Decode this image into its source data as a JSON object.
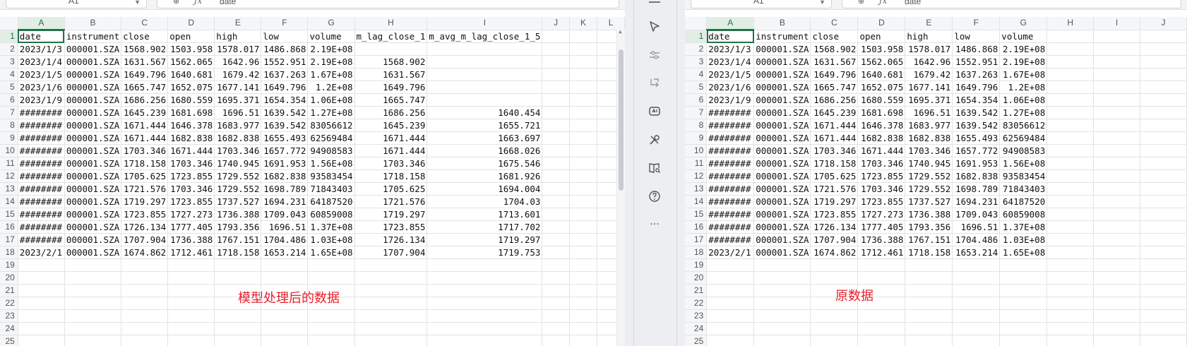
{
  "left_panel": {
    "name_box": "A1",
    "formula_value": "date",
    "caption": "模型处理后的数据",
    "columns": [
      "A",
      "B",
      "C",
      "D",
      "E",
      "F",
      "G",
      "H",
      "I",
      "J",
      "K",
      "L"
    ],
    "row_numbers": [
      "1",
      "2",
      "3",
      "4",
      "5",
      "6",
      "7",
      "8",
      "9",
      "10",
      "11",
      "12",
      "13",
      "14",
      "15",
      "16",
      "17",
      "18",
      "19",
      "20",
      "21",
      "22",
      "23",
      "24",
      "25"
    ],
    "rows": [
      [
        "date",
        "instrument",
        "close",
        "open",
        "high",
        "low",
        "volume",
        "m_lag_close_1",
        "m_avg_m_lag_close_1_5",
        "",
        "",
        ""
      ],
      [
        "2023/1/3",
        "000001.SZA",
        "1568.902",
        "1503.958",
        "1578.017",
        "1486.868",
        "2.19E+08",
        "",
        "",
        "",
        "",
        ""
      ],
      [
        "2023/1/4",
        "000001.SZA",
        "1631.567",
        "1562.065",
        "1642.96",
        "1552.951",
        "2.19E+08",
        "1568.902",
        "",
        "",
        "",
        ""
      ],
      [
        "2023/1/5",
        "000001.SZA",
        "1649.796",
        "1640.681",
        "1679.42",
        "1637.263",
        "1.67E+08",
        "1631.567",
        "",
        "",
        "",
        ""
      ],
      [
        "2023/1/6",
        "000001.SZA",
        "1665.747",
        "1652.075",
        "1677.141",
        "1649.796",
        "1.2E+08",
        "1649.796",
        "",
        "",
        "",
        ""
      ],
      [
        "2023/1/9",
        "000001.SZA",
        "1686.256",
        "1680.559",
        "1695.371",
        "1654.354",
        "1.06E+08",
        "1665.747",
        "",
        "",
        "",
        ""
      ],
      [
        "########",
        "000001.SZA",
        "1645.239",
        "1681.698",
        "1696.51",
        "1639.542",
        "1.27E+08",
        "1686.256",
        "1640.454",
        "",
        "",
        ""
      ],
      [
        "########",
        "000001.SZA",
        "1671.444",
        "1646.378",
        "1683.977",
        "1639.542",
        "83056612",
        "1645.239",
        "1655.721",
        "",
        "",
        ""
      ],
      [
        "########",
        "000001.SZA",
        "1671.444",
        "1682.838",
        "1682.838",
        "1655.493",
        "62569484",
        "1671.444",
        "1663.697",
        "",
        "",
        ""
      ],
      [
        "########",
        "000001.SZA",
        "1703.346",
        "1671.444",
        "1703.346",
        "1657.772",
        "94908583",
        "1671.444",
        "1668.026",
        "",
        "",
        ""
      ],
      [
        "########",
        "000001.SZA",
        "1718.158",
        "1703.346",
        "1740.945",
        "1691.953",
        "1.56E+08",
        "1703.346",
        "1675.546",
        "",
        "",
        ""
      ],
      [
        "########",
        "000001.SZA",
        "1705.625",
        "1723.855",
        "1729.552",
        "1682.838",
        "93583454",
        "1718.158",
        "1681.926",
        "",
        "",
        ""
      ],
      [
        "########",
        "000001.SZA",
        "1721.576",
        "1703.346",
        "1729.552",
        "1698.789",
        "71843403",
        "1705.625",
        "1694.004",
        "",
        "",
        ""
      ],
      [
        "########",
        "000001.SZA",
        "1719.297",
        "1723.855",
        "1737.527",
        "1694.231",
        "64187520",
        "1721.576",
        "1704.03",
        "",
        "",
        ""
      ],
      [
        "########",
        "000001.SZA",
        "1723.855",
        "1727.273",
        "1736.388",
        "1709.043",
        "60859008",
        "1719.297",
        "1713.601",
        "",
        "",
        ""
      ],
      [
        "########",
        "000001.SZA",
        "1726.134",
        "1777.405",
        "1793.356",
        "1696.51",
        "1.37E+08",
        "1723.855",
        "1717.702",
        "",
        "",
        ""
      ],
      [
        "########",
        "000001.SZA",
        "1707.904",
        "1736.388",
        "1767.151",
        "1704.486",
        "1.03E+08",
        "1726.134",
        "1719.297",
        "",
        "",
        ""
      ],
      [
        "2023/2/1",
        "000001.SZA",
        "1674.862",
        "1712.461",
        "1718.158",
        "1653.214",
        "1.65E+08",
        "1707.904",
        "1719.753",
        "",
        "",
        ""
      ],
      [
        "",
        "",
        "",
        "",
        "",
        "",
        "",
        "",
        "",
        "",
        "",
        ""
      ],
      [
        "",
        "",
        "",
        "",
        "",
        "",
        "",
        "",
        "",
        "",
        "",
        ""
      ],
      [
        "",
        "",
        "",
        "",
        "",
        "",
        "",
        "",
        "",
        "",
        "",
        ""
      ],
      [
        "",
        "",
        "",
        "",
        "",
        "",
        "",
        "",
        "",
        "",
        "",
        ""
      ],
      [
        "",
        "",
        "",
        "",
        "",
        "",
        "",
        "",
        "",
        "",
        "",
        ""
      ],
      [
        "",
        "",
        "",
        "",
        "",
        "",
        "",
        "",
        "",
        "",
        "",
        ""
      ],
      [
        "",
        "",
        "",
        "",
        "",
        "",
        "",
        "",
        "",
        "",
        "",
        ""
      ]
    ]
  },
  "right_panel": {
    "name_box": "A1",
    "formula_value": "date",
    "caption": "原数据",
    "columns": [
      "A",
      "B",
      "C",
      "D",
      "E",
      "F",
      "G",
      "H",
      "I",
      "J"
    ],
    "row_numbers": [
      "1",
      "2",
      "3",
      "4",
      "5",
      "6",
      "7",
      "8",
      "9",
      "10",
      "11",
      "12",
      "13",
      "14",
      "15",
      "16",
      "17",
      "18",
      "19",
      "20",
      "21",
      "22",
      "23",
      "24",
      "25"
    ],
    "rows": [
      [
        "date",
        "instrument",
        "close",
        "open",
        "high",
        "low",
        "volume",
        "",
        "",
        ""
      ],
      [
        "2023/1/3",
        "000001.SZA",
        "1568.902",
        "1503.958",
        "1578.017",
        "1486.868",
        "2.19E+08",
        "",
        "",
        ""
      ],
      [
        "2023/1/4",
        "000001.SZA",
        "1631.567",
        "1562.065",
        "1642.96",
        "1552.951",
        "2.19E+08",
        "",
        "",
        ""
      ],
      [
        "2023/1/5",
        "000001.SZA",
        "1649.796",
        "1640.681",
        "1679.42",
        "1637.263",
        "1.67E+08",
        "",
        "",
        ""
      ],
      [
        "2023/1/6",
        "000001.SZA",
        "1665.747",
        "1652.075",
        "1677.141",
        "1649.796",
        "1.2E+08",
        "",
        "",
        ""
      ],
      [
        "2023/1/9",
        "000001.SZA",
        "1686.256",
        "1680.559",
        "1695.371",
        "1654.354",
        "1.06E+08",
        "",
        "",
        ""
      ],
      [
        "########",
        "000001.SZA",
        "1645.239",
        "1681.698",
        "1696.51",
        "1639.542",
        "1.27E+08",
        "",
        "",
        ""
      ],
      [
        "########",
        "000001.SZA",
        "1671.444",
        "1646.378",
        "1683.977",
        "1639.542",
        "83056612",
        "",
        "",
        ""
      ],
      [
        "########",
        "000001.SZA",
        "1671.444",
        "1682.838",
        "1682.838",
        "1655.493",
        "62569484",
        "",
        "",
        ""
      ],
      [
        "########",
        "000001.SZA",
        "1703.346",
        "1671.444",
        "1703.346",
        "1657.772",
        "94908583",
        "",
        "",
        ""
      ],
      [
        "########",
        "000001.SZA",
        "1718.158",
        "1703.346",
        "1740.945",
        "1691.953",
        "1.56E+08",
        "",
        "",
        ""
      ],
      [
        "########",
        "000001.SZA",
        "1705.625",
        "1723.855",
        "1729.552",
        "1682.838",
        "93583454",
        "",
        "",
        ""
      ],
      [
        "########",
        "000001.SZA",
        "1721.576",
        "1703.346",
        "1729.552",
        "1698.789",
        "71843403",
        "",
        "",
        ""
      ],
      [
        "########",
        "000001.SZA",
        "1719.297",
        "1723.855",
        "1737.527",
        "1694.231",
        "64187520",
        "",
        "",
        ""
      ],
      [
        "########",
        "000001.SZA",
        "1723.855",
        "1727.273",
        "1736.388",
        "1709.043",
        "60859008",
        "",
        "",
        ""
      ],
      [
        "########",
        "000001.SZA",
        "1726.134",
        "1777.405",
        "1793.356",
        "1696.51",
        "1.37E+08",
        "",
        "",
        ""
      ],
      [
        "########",
        "000001.SZA",
        "1707.904",
        "1736.388",
        "1767.151",
        "1704.486",
        "1.03E+08",
        "",
        "",
        ""
      ],
      [
        "2023/2/1",
        "000001.SZA",
        "1674.862",
        "1712.461",
        "1718.158",
        "1653.214",
        "1.65E+08",
        "",
        "",
        ""
      ],
      [
        "",
        "",
        "",
        "",
        "",
        "",
        "",
        "",
        "",
        ""
      ],
      [
        "",
        "",
        "",
        "",
        "",
        "",
        "",
        "",
        "",
        ""
      ],
      [
        "",
        "",
        "",
        "",
        "",
        "",
        "",
        "",
        "",
        ""
      ],
      [
        "",
        "",
        "",
        "",
        "",
        "",
        "",
        "",
        "",
        ""
      ],
      [
        "",
        "",
        "",
        "",
        "",
        "",
        "",
        "",
        "",
        ""
      ],
      [
        "",
        "",
        "",
        "",
        "",
        "",
        "",
        "",
        "",
        ""
      ],
      [
        "",
        "",
        "",
        "",
        "",
        "",
        "",
        "",
        "",
        ""
      ]
    ]
  },
  "toolbar": {
    "icons": [
      "minimize-icon",
      "pointer-select-icon",
      "adjust-slider-icon",
      "flow-arrow-icon",
      "ai-assist-icon",
      "tools-icon",
      "book-search-icon",
      "help-icon",
      "more-icon"
    ],
    "more_label": "···"
  },
  "colors": {
    "selection": "#217346",
    "caption": "#e8202a"
  }
}
